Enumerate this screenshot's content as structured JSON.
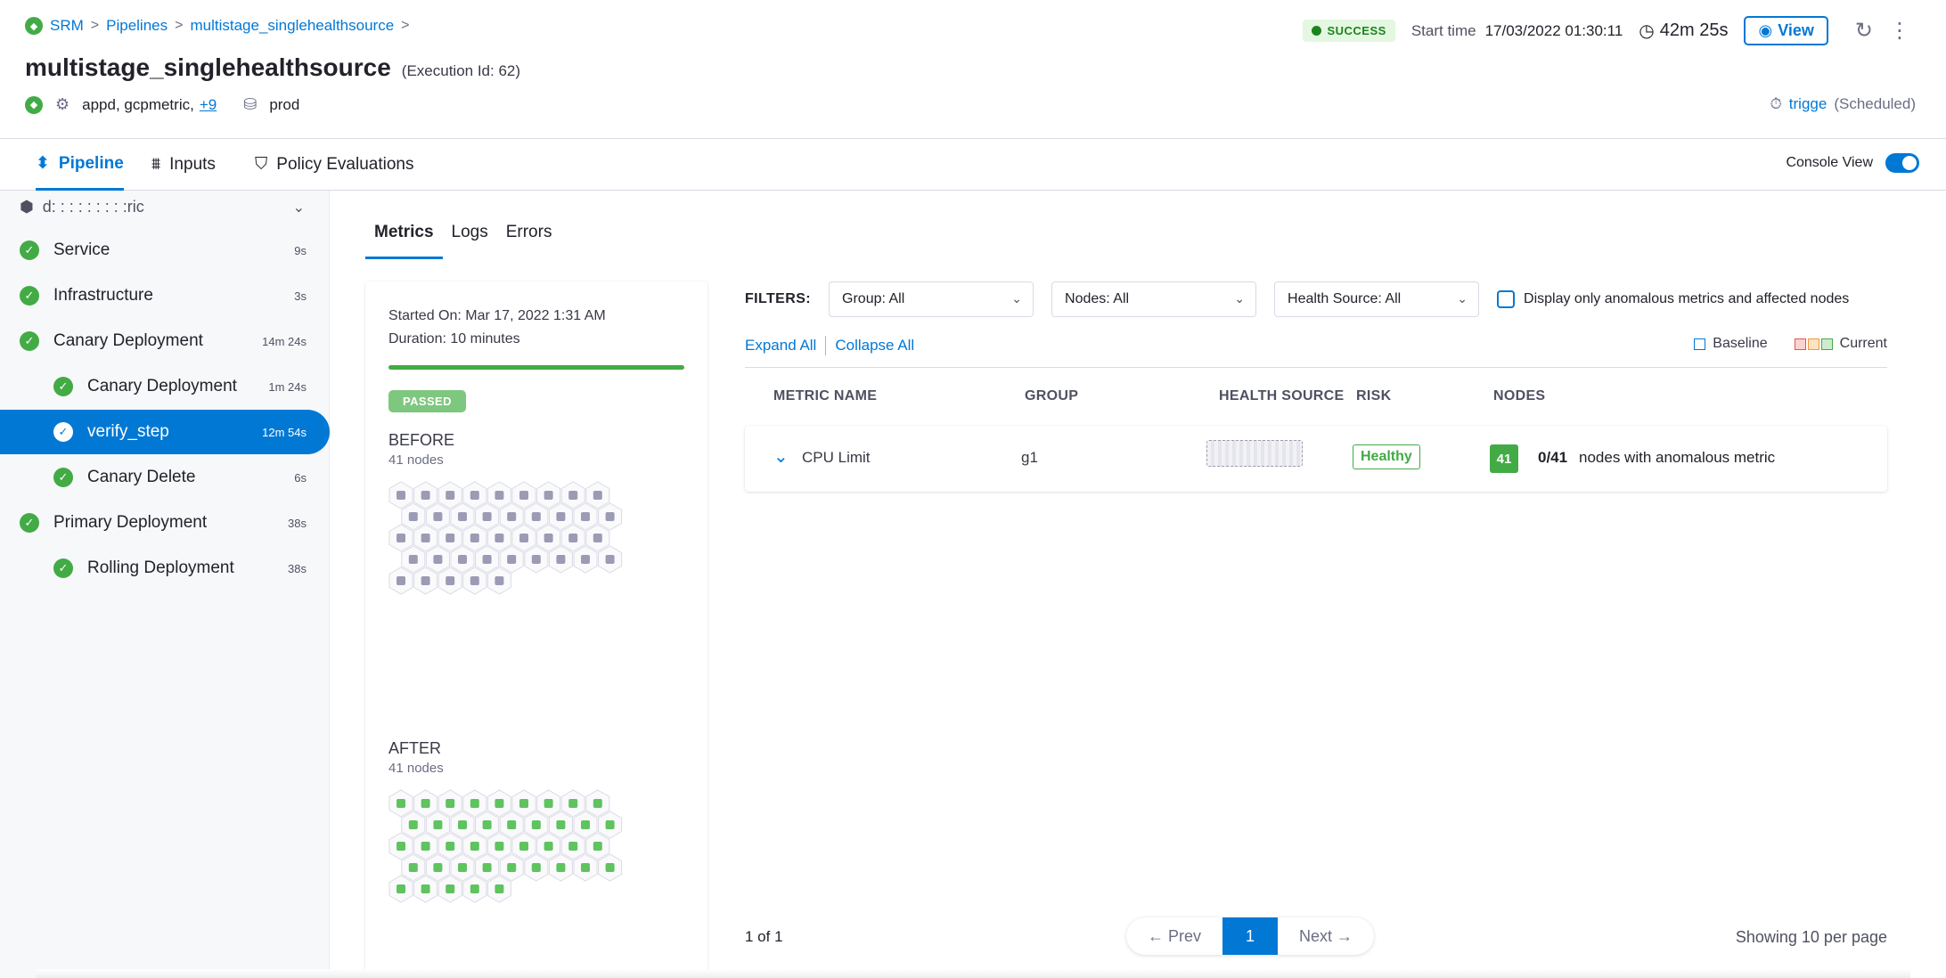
{
  "breadcrumb": {
    "items": [
      "SRM",
      "Pipelines",
      "multistage_singlehealthsource"
    ],
    "sep": ">"
  },
  "header": {
    "title": "multistage_singlehealthsource",
    "execution_id": "(Execution Id: 62)",
    "services": "appd, gcpmetric,",
    "services_more": "+9",
    "environment": "prod",
    "status": "SUCCESS",
    "start_label": "Start time",
    "start_time": "17/03/2022 01:30:11",
    "duration": "42m 25s",
    "view_label": "View",
    "trigger_name": "trigge",
    "trigger_type": "(Scheduled)"
  },
  "tabs": {
    "pipeline": "Pipeline",
    "inputs": "Inputs",
    "policy": "Policy Evaluations",
    "console_view": "Console View"
  },
  "sidebar": {
    "stage_name": "d: : : : : : : : :ric",
    "steps": [
      {
        "label": "Service",
        "time": "9s",
        "indent": false
      },
      {
        "label": "Infrastructure",
        "time": "3s",
        "indent": false
      },
      {
        "label": "Canary Deployment",
        "time": "14m 24s",
        "indent": false
      },
      {
        "label": "Canary Deployment",
        "time": "1m 24s",
        "indent": true
      },
      {
        "label": "verify_step",
        "time": "12m 54s",
        "indent": true,
        "selected": true
      },
      {
        "label": "Canary Delete",
        "time": "6s",
        "indent": true
      },
      {
        "label": "Primary Deployment",
        "time": "38s",
        "indent": false
      },
      {
        "label": "Rolling Deployment",
        "time": "38s",
        "indent": true
      }
    ]
  },
  "content_tabs": [
    "Metrics",
    "Logs",
    "Errors"
  ],
  "analysis": {
    "started_on": "Started On: Mar 17, 2022 1:31 AM",
    "duration": "Duration: 10 minutes",
    "progress": 1.0,
    "status": "PASSED",
    "before_label": "BEFORE",
    "before_nodes": "41 nodes",
    "after_label": "AFTER",
    "after_nodes": "41 nodes",
    "node_total": 41,
    "before_color": "#9b9bb5",
    "after_color": "#5fc35f"
  },
  "filters": {
    "label": "FILTERS:",
    "group": "Group: All",
    "nodes": "Nodes: All",
    "health_source": "Health Source: All",
    "anomalous_only": "Display only anomalous metrics and affected nodes"
  },
  "actions": {
    "expand_all": "Expand All",
    "collapse_all": "Collapse All"
  },
  "legend": {
    "baseline": "Baseline",
    "current": "Current"
  },
  "table": {
    "headers": {
      "metric": "METRIC NAME",
      "group": "GROUP",
      "health_source": "HEALTH SOURCE",
      "risk": "RISK",
      "nodes": "NODES"
    },
    "rows": [
      {
        "metric": "CPU Limit",
        "group": "g1",
        "risk": "Healthy",
        "node_count": "41",
        "anomalous": "0/41",
        "anomalous_text": "nodes with anomalous metric"
      }
    ]
  },
  "pagination": {
    "summary": "1 of 1",
    "prev": "← Prev",
    "current": "1",
    "next": "Next →",
    "per_page": "Showing 10 per page"
  },
  "colors": {
    "accent": "#0278d5",
    "success": "#42ab45"
  }
}
